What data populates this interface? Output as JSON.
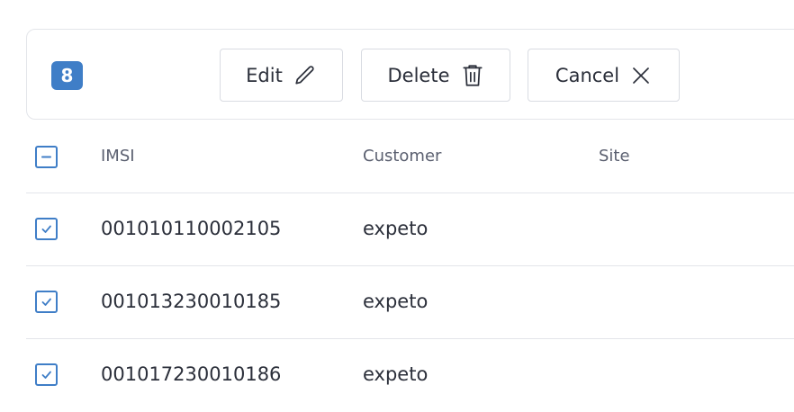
{
  "selection": {
    "count": "8"
  },
  "actions": {
    "edit_label": "Edit",
    "delete_label": "Delete",
    "cancel_label": "Cancel",
    "edit_icon": "pencil-icon",
    "delete_icon": "trash-icon",
    "cancel_icon": "close-icon"
  },
  "table": {
    "columns": [
      "IMSI",
      "Customer",
      "Site"
    ],
    "header_checkbox_state": "indeterminate",
    "rows": [
      {
        "imsi": "001010110002105",
        "customer": "expeto",
        "site": "",
        "checked": true
      },
      {
        "imsi": "001013230010185",
        "customer": "expeto",
        "site": "",
        "checked": true
      },
      {
        "imsi": "001017230010186",
        "customer": "expeto",
        "site": "",
        "checked": true
      }
    ]
  },
  "colors": {
    "accent": "#3f7ec7",
    "border": "#e3e5ea",
    "text": "#2b2f3a",
    "muted_text": "#5b6070"
  }
}
